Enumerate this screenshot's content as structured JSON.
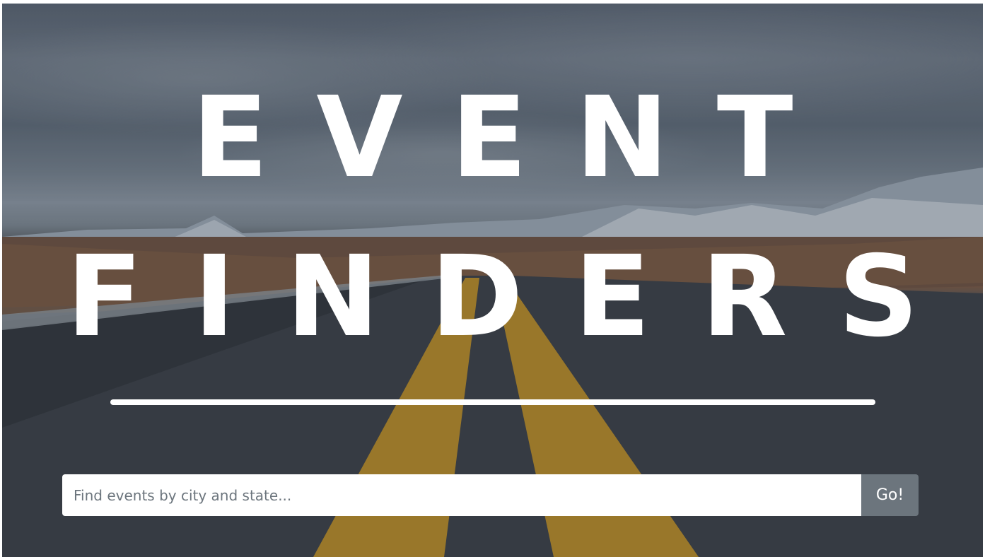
{
  "hero": {
    "title_line_1": "EVENT",
    "title_line_2": "FINDERS"
  },
  "search": {
    "placeholder": "Find events by city and state...",
    "value": "",
    "button_label": "Go!"
  },
  "colors": {
    "title_text": "#ffffff",
    "divider": "#ffffff",
    "input_background": "#ffffff",
    "button_background": "#6c757d",
    "button_text": "#ffffff"
  }
}
